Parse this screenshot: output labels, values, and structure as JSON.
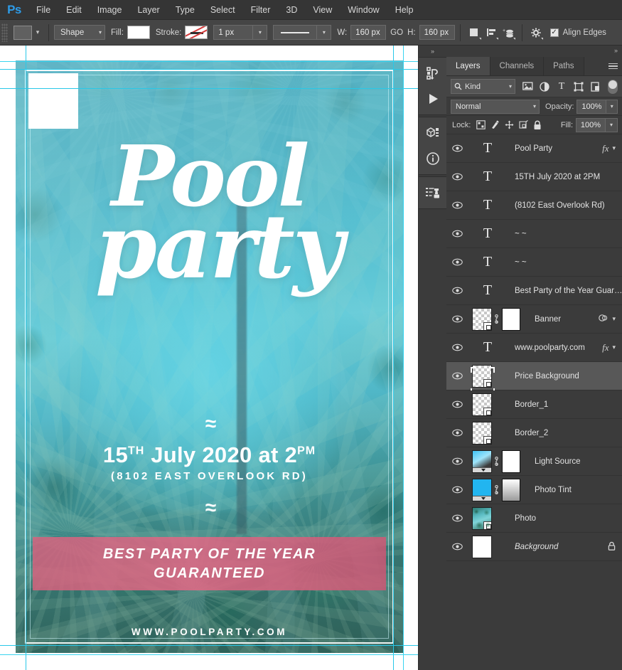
{
  "app": {
    "logo": "Ps"
  },
  "menubar": {
    "items": [
      {
        "label": "File"
      },
      {
        "label": "Edit"
      },
      {
        "label": "Image"
      },
      {
        "label": "Layer"
      },
      {
        "label": "Type"
      },
      {
        "label": "Select"
      },
      {
        "label": "Filter"
      },
      {
        "label": "3D"
      },
      {
        "label": "View"
      },
      {
        "label": "Window"
      },
      {
        "label": "Help"
      }
    ]
  },
  "optionsbar": {
    "tool_preset_label": "tool-preset-swatch",
    "mode_value": "Shape",
    "fill_label": "Fill:",
    "fill_value": "#ffffff",
    "stroke_label": "Stroke:",
    "stroke_value": "none",
    "stroke_width": "1 px",
    "line_style_label": "solid-line",
    "width_label": "W:",
    "width_value": "160 px",
    "link_label": "GO",
    "height_label": "H:",
    "height_value": "160 px",
    "path_ops_icon": "path-operations-icon",
    "path_align_icon": "path-alignment-icon",
    "path_arrange_icon": "path-arrangement-icon",
    "gear_icon": "gear-icon",
    "align_edges_label": "Align Edges",
    "align_edges_checked": true
  },
  "dock": {
    "collapse_label": "»",
    "buttons": [
      {
        "name": "history-icon"
      },
      {
        "name": "actions-play-icon"
      },
      {
        "name": "3d-icon"
      },
      {
        "name": "info-icon"
      },
      {
        "name": "clone-source-icon"
      }
    ]
  },
  "panel": {
    "collapse_label": "»",
    "tabs": [
      {
        "label": "Layers",
        "active": true
      },
      {
        "label": "Channels",
        "active": false
      },
      {
        "label": "Paths",
        "active": false
      }
    ],
    "menu_icon": "panel-menu-icon",
    "filter": {
      "kind_label": "Kind",
      "search_icon": "search-icon",
      "icons": [
        {
          "name": "filter-pixel-icon"
        },
        {
          "name": "filter-adjustment-icon"
        },
        {
          "name": "filter-type-icon"
        },
        {
          "name": "filter-shape-icon"
        },
        {
          "name": "filter-smartobject-icon"
        }
      ],
      "toggle_name": "filter-toggle"
    },
    "blend": {
      "mode_value": "Normal",
      "opacity_label": "Opacity:",
      "opacity_value": "100%"
    },
    "lock": {
      "label": "Lock:",
      "icons": [
        {
          "name": "lock-transparent-pixels-icon"
        },
        {
          "name": "lock-image-pixels-icon"
        },
        {
          "name": "lock-position-icon"
        },
        {
          "name": "lock-artboard-icon"
        },
        {
          "name": "lock-all-icon"
        }
      ],
      "fill_label": "Fill:",
      "fill_value": "100%"
    },
    "layers": [
      {
        "name": "Pool  Party",
        "type": "text",
        "fx": true,
        "selected": false,
        "chevron": true
      },
      {
        "name": "15TH July 2020 at 2PM",
        "type": "text",
        "fx": false,
        "selected": false,
        "chevron": false
      },
      {
        "name": "(8102 East Overlook Rd)",
        "type": "text",
        "fx": false,
        "selected": false,
        "chevron": false
      },
      {
        "name": "~ ~",
        "type": "text",
        "fx": false,
        "selected": false,
        "chevron": false
      },
      {
        "name": "~ ~",
        "type": "text",
        "fx": false,
        "selected": false,
        "chevron": false
      },
      {
        "name": "Best Party of the Year Guar…",
        "type": "text",
        "fx": false,
        "selected": false,
        "chevron": false
      },
      {
        "name": "Banner",
        "type": "shape-masked",
        "fx": false,
        "selected": false,
        "chevron": true,
        "effects_icon": true
      },
      {
        "name": "www.poolparty.com",
        "type": "text",
        "fx": true,
        "selected": false,
        "chevron": true
      },
      {
        "name": "Price Background",
        "type": "shape",
        "fx": false,
        "selected": true,
        "chevron": false
      },
      {
        "name": "Border_1",
        "type": "shape",
        "fx": false,
        "selected": false,
        "chevron": false
      },
      {
        "name": "Border_2",
        "type": "shape",
        "fx": false,
        "selected": false,
        "chevron": false
      },
      {
        "name": "Light Source",
        "type": "lightsrc-masked",
        "fx": false,
        "selected": false,
        "chevron": false
      },
      {
        "name": "Photo Tint",
        "type": "tint-masked",
        "fx": false,
        "selected": false,
        "chevron": false
      },
      {
        "name": "Photo",
        "type": "photo",
        "fx": false,
        "selected": false,
        "chevron": false
      },
      {
        "name": "Background",
        "type": "white",
        "fx": false,
        "selected": false,
        "chevron": false,
        "locked": true,
        "italic": true
      }
    ]
  },
  "flyer": {
    "title_line1": "Pool",
    "title_line2": "party",
    "wave_top": "≈",
    "date": "15",
    "date_sup": "TH",
    "date_rest": " July 2020 at 2",
    "date_sup2": "PM",
    "address": "(8102 EAST OVERLOOK RD)",
    "wave_bottom": "≈",
    "banner_line1": "BEST PARTY OF THE YEAR",
    "banner_line2": "GUARANTEED",
    "website": "WWW.POOLPARTY.COM",
    "accent_pink": "#dd607d",
    "guide_color": "#29c8e8"
  }
}
